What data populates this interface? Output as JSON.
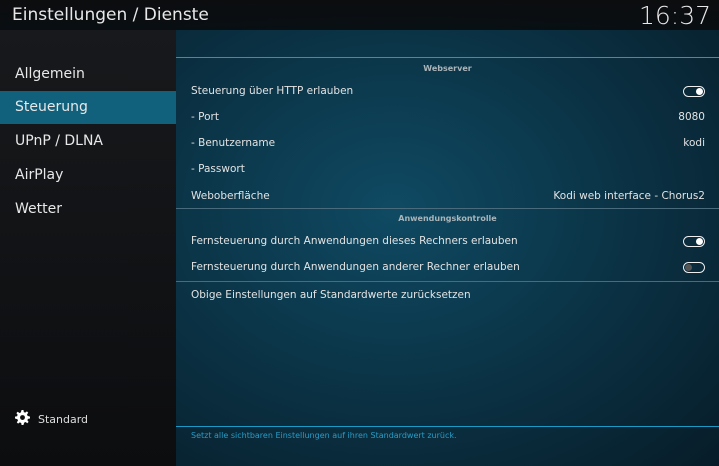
{
  "header": {
    "title": "Einstellungen / Dienste",
    "clock": "16:37"
  },
  "sidebar": {
    "items": [
      {
        "label": "Allgemein"
      },
      {
        "label": "Steuerung",
        "selected": true
      },
      {
        "label": "UPnP / DLNA"
      },
      {
        "label": "AirPlay"
      },
      {
        "label": "Wetter"
      }
    ],
    "level_label": "Standard"
  },
  "sections": [
    {
      "title": "Webserver",
      "rows": [
        {
          "label": "Steuerung über HTTP erlauben",
          "toggle": true
        },
        {
          "label": "- Port",
          "value": "8080"
        },
        {
          "label": "- Benutzername",
          "value": "kodi"
        },
        {
          "label": "- Passwort",
          "value": ""
        },
        {
          "label": "Weboberfläche",
          "value": "Kodi web interface - Chorus2"
        }
      ]
    },
    {
      "title": "Anwendungskontrolle",
      "rows": [
        {
          "label": "Fernsteuerung durch Anwendungen dieses Rechners erlauben",
          "toggle": true
        },
        {
          "label": "Fernsteuerung durch Anwendungen anderer Rechner erlauben",
          "toggle": false
        }
      ]
    }
  ],
  "reset_label": "Obige Einstellungen auf Standardwerte zurücksetzen",
  "help_text": "Setzt alle sichtbaren Einstellungen auf ihren Standardwert zurück."
}
